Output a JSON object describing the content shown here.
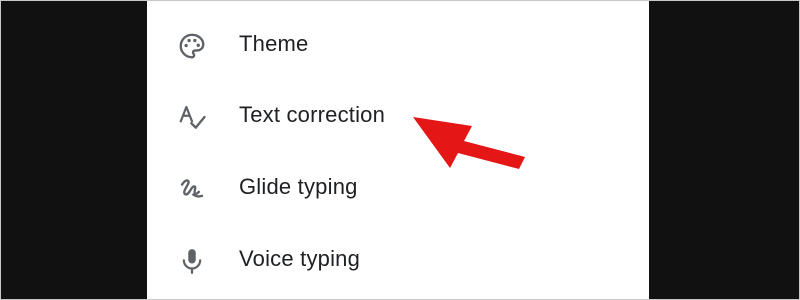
{
  "settings_menu": {
    "items": [
      {
        "label": "Theme",
        "icon": "palette-icon"
      },
      {
        "label": "Text correction",
        "icon": "spellcheck-icon"
      },
      {
        "label": "Glide typing",
        "icon": "gesture-icon"
      },
      {
        "label": "Voice typing",
        "icon": "microphone-icon"
      }
    ]
  },
  "annotation": {
    "arrow_color": "#e51616",
    "points_to": "Text correction"
  },
  "colors": {
    "background": "#111111",
    "panel": "#ffffff",
    "text": "#202124",
    "icon": "#5f6368"
  }
}
